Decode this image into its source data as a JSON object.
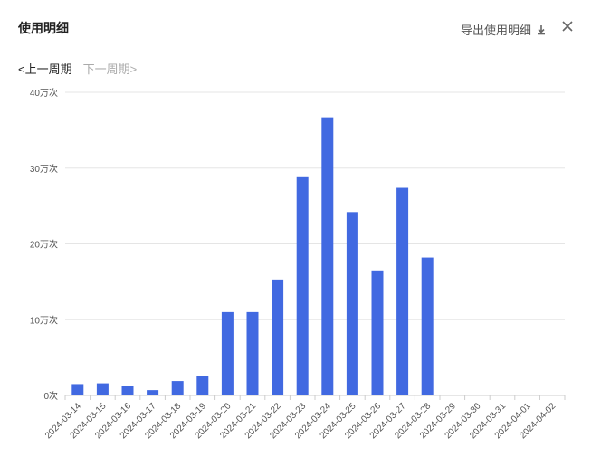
{
  "header": {
    "title": "使用明细",
    "export_label": "导出使用明细",
    "export_icon": "download-icon",
    "close_icon": "close-icon"
  },
  "nav": {
    "prev_label": "<上一周期",
    "next_label": "下一周期>"
  },
  "colors": {
    "bar": "#4169e1",
    "grid": "#e5e5e5"
  },
  "chart_data": {
    "type": "bar",
    "categories": [
      "2024-03-14",
      "2024-03-15",
      "2024-03-16",
      "2024-03-17",
      "2024-03-18",
      "2024-03-19",
      "2024-03-20",
      "2024-03-21",
      "2024-03-22",
      "2024-03-23",
      "2024-03-24",
      "2024-03-25",
      "2024-03-26",
      "2024-03-27",
      "2024-03-28",
      "2024-03-29",
      "2024-03-30",
      "2024-03-31",
      "2024-04-01",
      "2024-04-02"
    ],
    "values": [
      15000,
      16000,
      12000,
      7000,
      19000,
      26000,
      110000,
      110000,
      153000,
      288000,
      367000,
      242000,
      165000,
      274000,
      182000,
      0,
      0,
      0,
      0,
      0
    ],
    "ylim": [
      0,
      400000
    ],
    "yticks": [
      0,
      100000,
      200000,
      300000,
      400000
    ],
    "ytick_labels": [
      "0次",
      "10万次",
      "20万次",
      "30万次",
      "40万次"
    ],
    "grid": true
  }
}
